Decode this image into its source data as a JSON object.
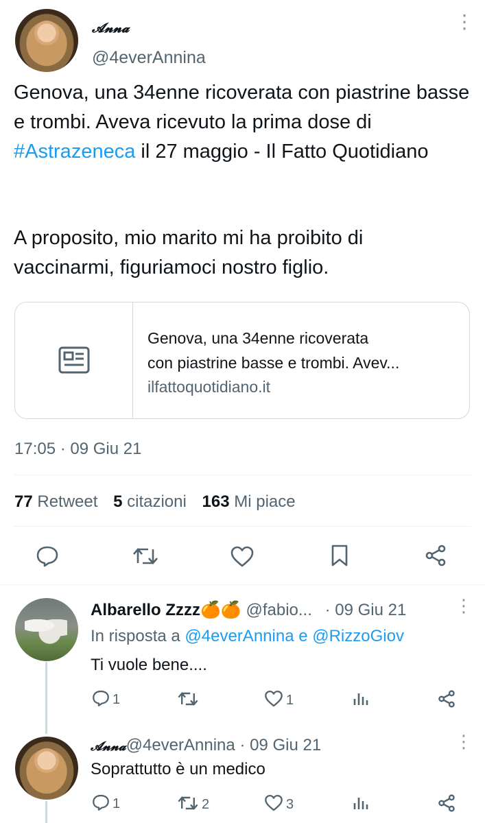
{
  "tweet": {
    "display_name": "𝓐𝓷𝓷𝓪",
    "handle": "@4everAnnina",
    "text_part1": "Genova, una 34enne ricoverata con piastrine basse e trombi. Aveva ricevuto la prima dose di ",
    "hashtag": "#Astrazeneca",
    "text_part2": " il 27 maggio - Il Fatto Quotidiano",
    "text_para2": "A proposito, mio marito mi ha proibito di vaccinarmi, figuriamoci nostro figlio.",
    "card": {
      "title_line1": "Genova, una 34enne ricoverata",
      "title_line2": "con piastrine basse e trombi. Avev...",
      "domain": "ilfattoquotidiano.it"
    },
    "timestamp": "17:05 · 09 Giu 21",
    "stats": {
      "retweets": "77",
      "retweets_label": "Retweet",
      "quotes": "5",
      "quotes_label": "citazioni",
      "likes": "163",
      "likes_label": "Mi piace"
    }
  },
  "replies": [
    {
      "display_name": "Albarello Zzzz",
      "emoji": "🍊🍊",
      "handle": "@fabio...",
      "date": "· 09 Giu 21",
      "in_reply_prefix": "In risposta a ",
      "mention1": "@4everAnnina",
      "conj": " e ",
      "mention2": "@RizzoGiov",
      "text": "Ti vuole bene....",
      "reply_count": "1",
      "retweet_count": "",
      "like_count": "1"
    },
    {
      "display_name": "𝓐𝓷𝓷𝓪",
      "handle": "@4everAnnina",
      "date": "· 09 Giu 21",
      "text": "Soprattutto è un medico",
      "reply_count": "1",
      "retweet_count": "2",
      "like_count": "3"
    }
  ],
  "icons": [
    "more-icon",
    "news-card-icon",
    "reply-icon",
    "retweet-icon",
    "like-icon",
    "bookmark-icon",
    "share-icon",
    "views-icon"
  ],
  "colors": {
    "link": "#1d9bf0",
    "secondary": "#536471",
    "divider": "#eff3f4",
    "icon": "#536471"
  }
}
